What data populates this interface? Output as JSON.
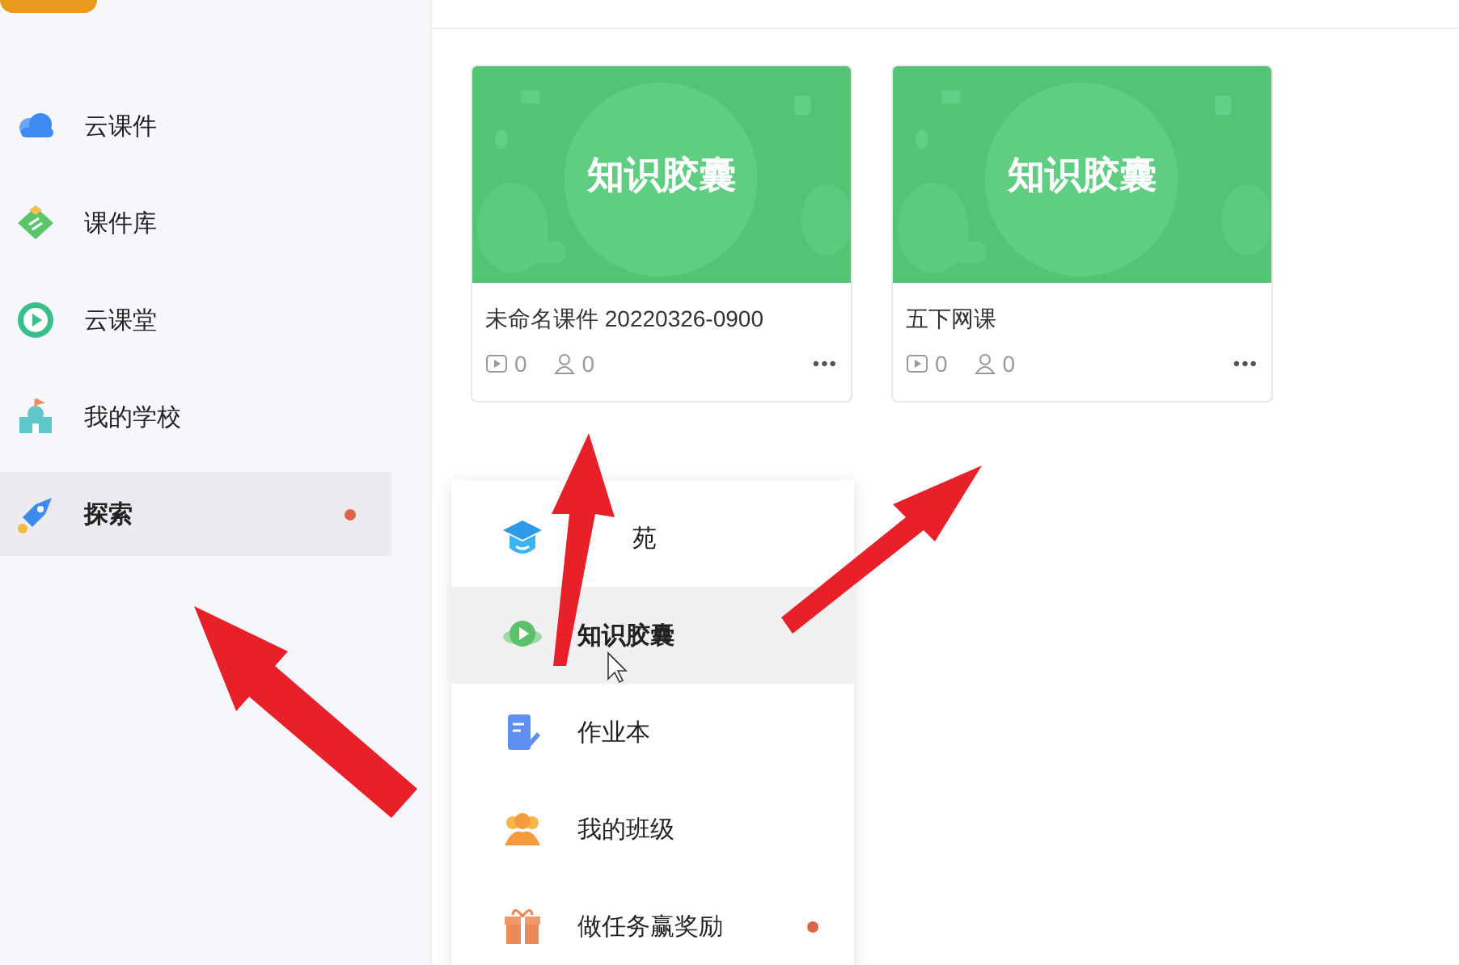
{
  "sidebar": {
    "items": [
      {
        "label": "云课件",
        "selected": false,
        "dot": false
      },
      {
        "label": "课件库",
        "selected": false,
        "dot": false
      },
      {
        "label": "云课堂",
        "selected": false,
        "dot": false
      },
      {
        "label": "我的学校",
        "selected": false,
        "dot": false
      },
      {
        "label": "探索",
        "selected": true,
        "dot": true
      }
    ]
  },
  "cards": [
    {
      "cover_title": "知识胶囊",
      "title": "未命名课件 20220326-0900",
      "videos": "0",
      "students": "0",
      "more": "•••"
    },
    {
      "cover_title": "知识胶囊",
      "title": "五下网课",
      "videos": "0",
      "students": "0",
      "more": "•••"
    }
  ],
  "menu": {
    "items": [
      {
        "label": "苑",
        "kind": "covered",
        "selected": false,
        "dot": false
      },
      {
        "label": "知识胶囊",
        "kind": "plain",
        "selected": true,
        "dot": false
      },
      {
        "label": "作业本",
        "kind": "plain",
        "selected": false,
        "dot": false
      },
      {
        "label": "我的班级",
        "kind": "plain",
        "selected": false,
        "dot": false
      },
      {
        "label": "做任务赢奖励",
        "kind": "plain",
        "selected": false,
        "dot": true
      }
    ]
  }
}
